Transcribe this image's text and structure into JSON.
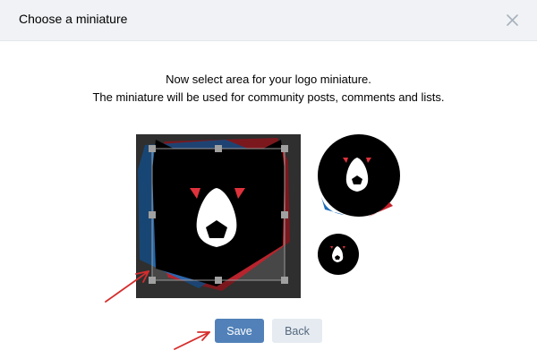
{
  "dialog": {
    "title": "Choose a miniature",
    "close_icon": "close-icon"
  },
  "instructions": {
    "line1": "Now select area for your logo miniature.",
    "line2": "The miniature will be used for community posts, comments and lists."
  },
  "editor": {
    "image": "bear-logo",
    "crop_handles": 8
  },
  "previews": {
    "large": "bear-logo-preview-large",
    "small": "bear-logo-preview-small"
  },
  "buttons": {
    "save_label": "Save",
    "back_label": "Back"
  },
  "colors": {
    "primary": "#5181b8",
    "secondary_bg": "#e5ebf1",
    "annotation_arrow": "#d62d2d",
    "logo_red": "#e0323c",
    "logo_blue": "#1f6db8"
  }
}
